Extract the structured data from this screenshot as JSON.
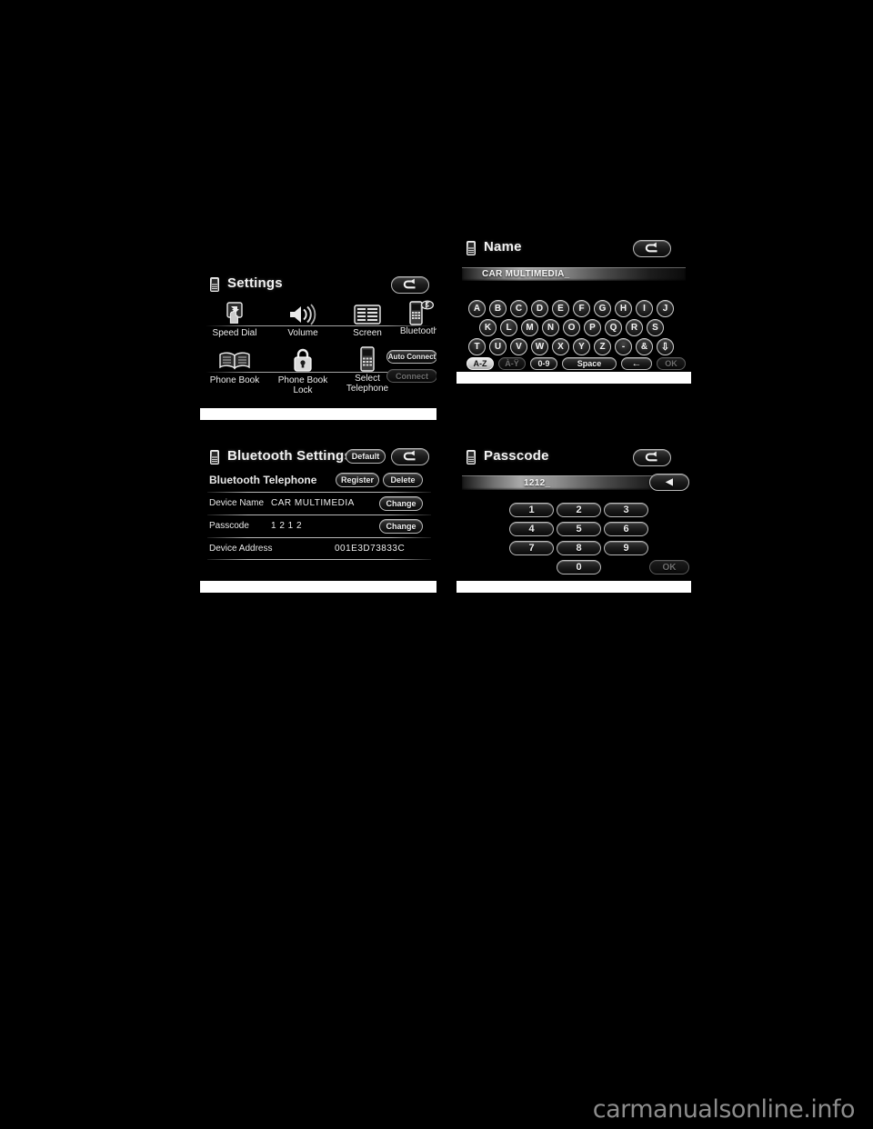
{
  "page": {
    "background": "#000000",
    "watermark": "carmanualsonline.info"
  },
  "screens": {
    "settings": {
      "title": "Settings",
      "title_icon": "phone-icon",
      "back_label": "back-arrow-icon",
      "tiles": [
        {
          "label": "Speed Dial",
          "icon": "speed-dial-icon"
        },
        {
          "label": "Volume",
          "icon": "volume-icon"
        },
        {
          "label": "Screen",
          "icon": "screen-icon"
        },
        {
          "label": "Bluetooth",
          "icon": "bluetooth-phone-icon"
        },
        {
          "label": "Phone Book",
          "icon": "phone-book-icon"
        },
        {
          "label": "Phone Book\nLock",
          "line1": "Phone Book",
          "line2": "Lock",
          "icon": "lock-icon"
        },
        {
          "label": "Select\nTelephone",
          "line1": "Select",
          "line2": "Telephone",
          "icon": "select-telephone-icon"
        }
      ],
      "auto_connect_label": "Auto Connect",
      "connect_label": "Connect",
      "connect_enabled": false
    },
    "bluetooth_settings": {
      "title": "Bluetooth Settings",
      "default_label": "Default",
      "back_label": "back-arrow-icon",
      "rows": [
        {
          "label": "Bluetooth Telephone",
          "value": "",
          "buttons": [
            "Register",
            "Delete"
          ]
        },
        {
          "label": "Device Name",
          "value": "CAR MULTIMEDIA",
          "buttons": [
            "Change"
          ]
        },
        {
          "label": "Passcode",
          "value": "1 2 1 2",
          "buttons": [
            "Change"
          ]
        },
        {
          "label": "Device Address",
          "value": "001E3D73833C",
          "buttons": []
        }
      ]
    },
    "name": {
      "title": "Name",
      "back_label": "back-arrow-icon",
      "input_value": "CAR MULTIMEDIA",
      "caret": "_",
      "keyboard": {
        "row1": [
          "A",
          "B",
          "C",
          "D",
          "E",
          "F",
          "G",
          "H",
          "I",
          "J"
        ],
        "row2": [
          "K",
          "L",
          "M",
          "N",
          "O",
          "P",
          "Q",
          "R",
          "S"
        ],
        "row3": [
          "T",
          "U",
          "V",
          "W",
          "X",
          "Y",
          "Z",
          "-",
          "&",
          "⇩"
        ],
        "mode_az": "A-Z",
        "mode_accent": "À-Ÿ",
        "mode_num": "0-9",
        "space": "Space",
        "backspace": "←",
        "ok": "OK",
        "active_mode": "A-Z"
      }
    },
    "passcode": {
      "title": "Passcode",
      "back_label": "back-arrow-icon",
      "input_value": "1212",
      "caret": "_",
      "delete_label": "◀",
      "keys": [
        "1",
        "2",
        "3",
        "4",
        "5",
        "6",
        "7",
        "8",
        "9",
        "0"
      ],
      "ok": "OK",
      "ok_enabled": false
    }
  }
}
